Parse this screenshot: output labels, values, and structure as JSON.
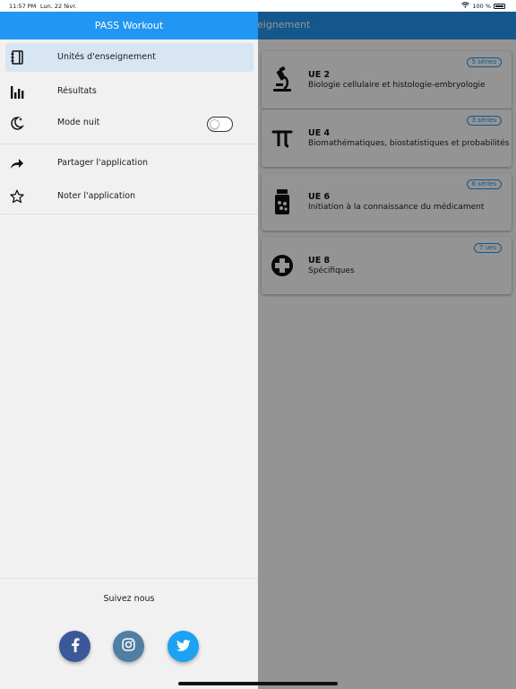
{
  "status_bar": {
    "time": "11:57 PM",
    "date": "Lun. 22 févr.",
    "battery": "100 %",
    "battery_level": 1.0,
    "wifi_icon": "wifi-icon"
  },
  "main": {
    "title": "eignement",
    "cards": [
      {
        "code": "UE 2",
        "name": "Biologie cellulaire et histologie-embryologie",
        "badge": "5 séries",
        "icon": "microscope-icon"
      },
      {
        "code": "UE 4",
        "name": "Biomathématiques, biostatistiques et probabilités",
        "badge": "3 séries",
        "icon": "pi-icon"
      },
      {
        "code": "UE 6",
        "name": "Initiation à la connaissance du médicament",
        "badge": "6 séries",
        "icon": "pill-bottle-icon"
      },
      {
        "code": "UE 8",
        "name": "Spécifiques",
        "badge": "7 ues",
        "icon": "medical-cross-icon"
      }
    ]
  },
  "drawer": {
    "title": "PASS Workout",
    "items": [
      {
        "label": "Unités d'enseignement",
        "icon": "notebook-icon",
        "active": true
      },
      {
        "label": "Résultats",
        "icon": "bar-chart-icon",
        "active": false
      },
      {
        "label": "Mode nuit",
        "icon": "moon-icon",
        "active": false,
        "toggle": false
      },
      {
        "label": "Partager l'application",
        "icon": "share-icon",
        "active": false
      },
      {
        "label": "Noter l'application",
        "icon": "star-icon",
        "active": false
      }
    ],
    "follow_title": "Suivez nous",
    "social": [
      {
        "name": "facebook",
        "icon": "facebook-icon",
        "color": "#3b5998"
      },
      {
        "name": "instagram",
        "icon": "instagram-icon",
        "color": "#517fa4"
      },
      {
        "name": "twitter",
        "icon": "twitter-icon",
        "color": "#1da1f2"
      }
    ]
  },
  "colors": {
    "primary": "#2196f3",
    "drawer_bg": "#f1f1f1",
    "active_item_bg": "#d8e6f3"
  }
}
